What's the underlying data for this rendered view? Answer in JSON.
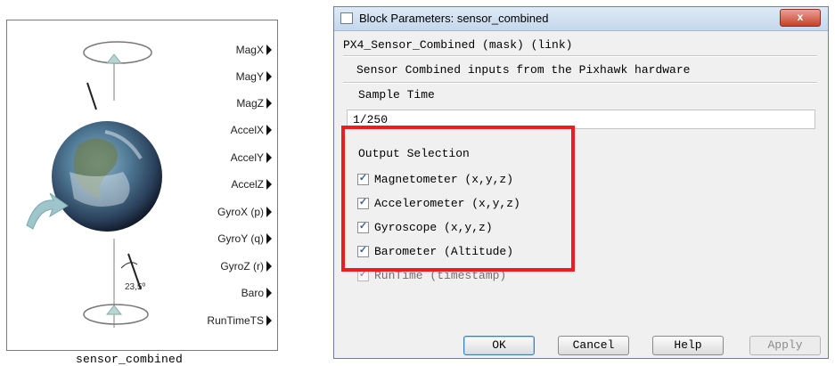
{
  "block": {
    "caption": "sensor_combined",
    "ports": [
      "MagX",
      "MagY",
      "MagZ",
      "AccelX",
      "AccelY",
      "AccelZ",
      "GyroX (p)",
      "GyroY (q)",
      "GyroZ (r)",
      "Baro",
      "RunTimeTS"
    ],
    "tilt_label": "23,5º"
  },
  "dialog": {
    "title": "Block Parameters: sensor_combined",
    "close_label": "x",
    "mask_header": "PX4_Sensor_Combined (mask) (link)",
    "description": "Sensor Combined inputs from the Pixhawk hardware",
    "sample_time_label": "Sample Time",
    "sample_time_value": "1/250",
    "output_selection_label": "Output Selection",
    "options": [
      {
        "label": "Magnetometer (x,y,z)",
        "checked": true
      },
      {
        "label": "Accelerometer (x,y,z)",
        "checked": true
      },
      {
        "label": "Gyroscope (x,y,z)",
        "checked": true
      },
      {
        "label": "Barometer (Altitude)",
        "checked": true
      },
      {
        "label": "RunTime (timestamp)",
        "checked": true
      }
    ],
    "buttons": {
      "ok": "OK",
      "cancel": "Cancel",
      "help": "Help",
      "apply": "Apply"
    }
  },
  "colors": {
    "highlight": "#ee1c1c",
    "check": "#3a5d9a"
  }
}
